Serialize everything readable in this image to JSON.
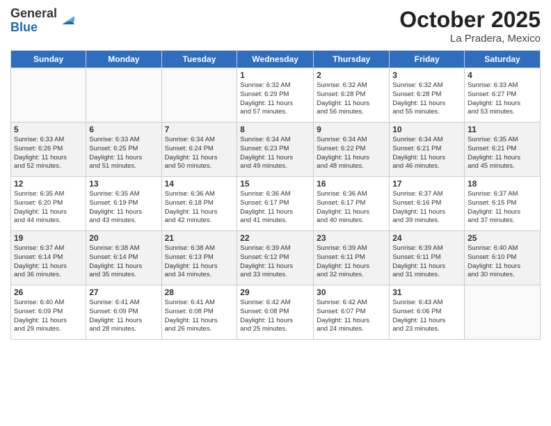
{
  "logo": {
    "general": "General",
    "blue": "Blue"
  },
  "title": "October 2025",
  "location": "La Pradera, Mexico",
  "days_of_week": [
    "Sunday",
    "Monday",
    "Tuesday",
    "Wednesday",
    "Thursday",
    "Friday",
    "Saturday"
  ],
  "weeks": [
    [
      {
        "day": "",
        "info": ""
      },
      {
        "day": "",
        "info": ""
      },
      {
        "day": "",
        "info": ""
      },
      {
        "day": "1",
        "info": "Sunrise: 6:32 AM\nSunset: 6:29 PM\nDaylight: 11 hours\nand 57 minutes."
      },
      {
        "day": "2",
        "info": "Sunrise: 6:32 AM\nSunset: 6:28 PM\nDaylight: 11 hours\nand 56 minutes."
      },
      {
        "day": "3",
        "info": "Sunrise: 6:32 AM\nSunset: 6:28 PM\nDaylight: 11 hours\nand 55 minutes."
      },
      {
        "day": "4",
        "info": "Sunrise: 6:33 AM\nSunset: 6:27 PM\nDaylight: 11 hours\nand 53 minutes."
      }
    ],
    [
      {
        "day": "5",
        "info": "Sunrise: 6:33 AM\nSunset: 6:26 PM\nDaylight: 11 hours\nand 52 minutes."
      },
      {
        "day": "6",
        "info": "Sunrise: 6:33 AM\nSunset: 6:25 PM\nDaylight: 11 hours\nand 51 minutes."
      },
      {
        "day": "7",
        "info": "Sunrise: 6:34 AM\nSunset: 6:24 PM\nDaylight: 11 hours\nand 50 minutes."
      },
      {
        "day": "8",
        "info": "Sunrise: 6:34 AM\nSunset: 6:23 PM\nDaylight: 11 hours\nand 49 minutes."
      },
      {
        "day": "9",
        "info": "Sunrise: 6:34 AM\nSunset: 6:22 PM\nDaylight: 11 hours\nand 48 minutes."
      },
      {
        "day": "10",
        "info": "Sunrise: 6:34 AM\nSunset: 6:21 PM\nDaylight: 11 hours\nand 46 minutes."
      },
      {
        "day": "11",
        "info": "Sunrise: 6:35 AM\nSunset: 6:21 PM\nDaylight: 11 hours\nand 45 minutes."
      }
    ],
    [
      {
        "day": "12",
        "info": "Sunrise: 6:35 AM\nSunset: 6:20 PM\nDaylight: 11 hours\nand 44 minutes."
      },
      {
        "day": "13",
        "info": "Sunrise: 6:35 AM\nSunset: 6:19 PM\nDaylight: 11 hours\nand 43 minutes."
      },
      {
        "day": "14",
        "info": "Sunrise: 6:36 AM\nSunset: 6:18 PM\nDaylight: 11 hours\nand 42 minutes."
      },
      {
        "day": "15",
        "info": "Sunrise: 6:36 AM\nSunset: 6:17 PM\nDaylight: 11 hours\nand 41 minutes."
      },
      {
        "day": "16",
        "info": "Sunrise: 6:36 AM\nSunset: 6:17 PM\nDaylight: 11 hours\nand 40 minutes."
      },
      {
        "day": "17",
        "info": "Sunrise: 6:37 AM\nSunset: 6:16 PM\nDaylight: 11 hours\nand 39 minutes."
      },
      {
        "day": "18",
        "info": "Sunrise: 6:37 AM\nSunset: 6:15 PM\nDaylight: 11 hours\nand 37 minutes."
      }
    ],
    [
      {
        "day": "19",
        "info": "Sunrise: 6:37 AM\nSunset: 6:14 PM\nDaylight: 11 hours\nand 36 minutes."
      },
      {
        "day": "20",
        "info": "Sunrise: 6:38 AM\nSunset: 6:14 PM\nDaylight: 11 hours\nand 35 minutes."
      },
      {
        "day": "21",
        "info": "Sunrise: 6:38 AM\nSunset: 6:13 PM\nDaylight: 11 hours\nand 34 minutes."
      },
      {
        "day": "22",
        "info": "Sunrise: 6:39 AM\nSunset: 6:12 PM\nDaylight: 11 hours\nand 33 minutes."
      },
      {
        "day": "23",
        "info": "Sunrise: 6:39 AM\nSunset: 6:11 PM\nDaylight: 11 hours\nand 32 minutes."
      },
      {
        "day": "24",
        "info": "Sunrise: 6:39 AM\nSunset: 6:11 PM\nDaylight: 11 hours\nand 31 minutes."
      },
      {
        "day": "25",
        "info": "Sunrise: 6:40 AM\nSunset: 6:10 PM\nDaylight: 11 hours\nand 30 minutes."
      }
    ],
    [
      {
        "day": "26",
        "info": "Sunrise: 6:40 AM\nSunset: 6:09 PM\nDaylight: 11 hours\nand 29 minutes."
      },
      {
        "day": "27",
        "info": "Sunrise: 6:41 AM\nSunset: 6:09 PM\nDaylight: 11 hours\nand 28 minutes."
      },
      {
        "day": "28",
        "info": "Sunrise: 6:41 AM\nSunset: 6:08 PM\nDaylight: 11 hours\nand 26 minutes."
      },
      {
        "day": "29",
        "info": "Sunrise: 6:42 AM\nSunset: 6:08 PM\nDaylight: 11 hours\nand 25 minutes."
      },
      {
        "day": "30",
        "info": "Sunrise: 6:42 AM\nSunset: 6:07 PM\nDaylight: 11 hours\nand 24 minutes."
      },
      {
        "day": "31",
        "info": "Sunrise: 6:43 AM\nSunset: 6:06 PM\nDaylight: 11 hours\nand 23 minutes."
      },
      {
        "day": "",
        "info": ""
      }
    ]
  ]
}
